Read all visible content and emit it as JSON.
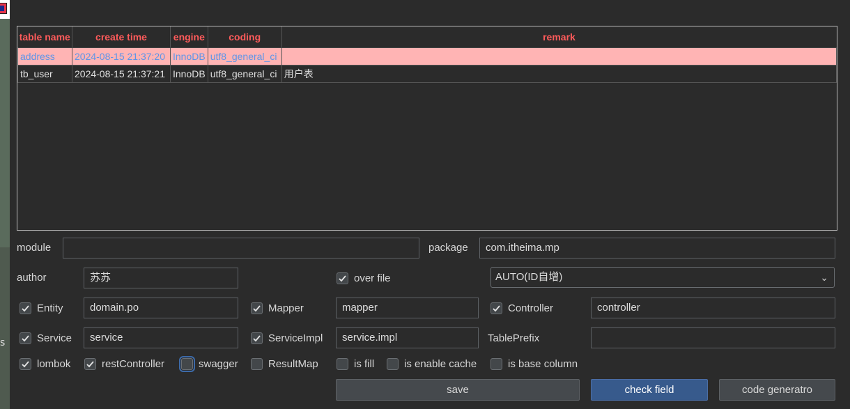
{
  "desktop": {
    "partial_text": "s"
  },
  "titlebar": {
    "minimize": "—",
    "close": "✕"
  },
  "table": {
    "columns": [
      "table name",
      "create time",
      "engine",
      "coding",
      "remark"
    ],
    "rows": [
      [
        "address",
        "2024-08-15 21:37:20",
        "InnoDB",
        "utf8_general_ci",
        ""
      ],
      [
        "tb_user",
        "2024-08-15 21:37:21",
        "InnoDB",
        "utf8_general_ci",
        "用户表"
      ]
    ]
  },
  "form": {
    "module_label": "module",
    "module_value": "",
    "package_label": "package",
    "package_value": "com.itheima.mp",
    "author_label": "author",
    "author_value": "苏苏",
    "over_file_label": "over file",
    "id_type_value": "AUTO(ID自增)",
    "entity_label": "Entity",
    "entity_value": "domain.po",
    "mapper_label": "Mapper",
    "mapper_value": "mapper",
    "controller_label": "Controller",
    "controller_value": "controller",
    "service_label": "Service",
    "service_value": "service",
    "serviceimpl_label": "ServiceImpl",
    "serviceimpl_value": "service.impl",
    "tableprefix_label": "TablePrefix",
    "tableprefix_value": "",
    "lombok_label": "lombok",
    "restcontroller_label": "restController",
    "swagger_label": "swagger",
    "resultmap_label": "ResultMap",
    "isfill_label": "is fill",
    "iscache_label": "is enable cache",
    "isbase_label": "is base column",
    "chev": "⌄"
  },
  "buttons": {
    "save": "save",
    "check_field": "check field",
    "code_generatro": "code generatro"
  },
  "colors": {
    "accent": "#375a8c",
    "header_text": "#ff5b5b",
    "selected_row": "#ffb4b4",
    "selected_text": "#5e95e8"
  }
}
